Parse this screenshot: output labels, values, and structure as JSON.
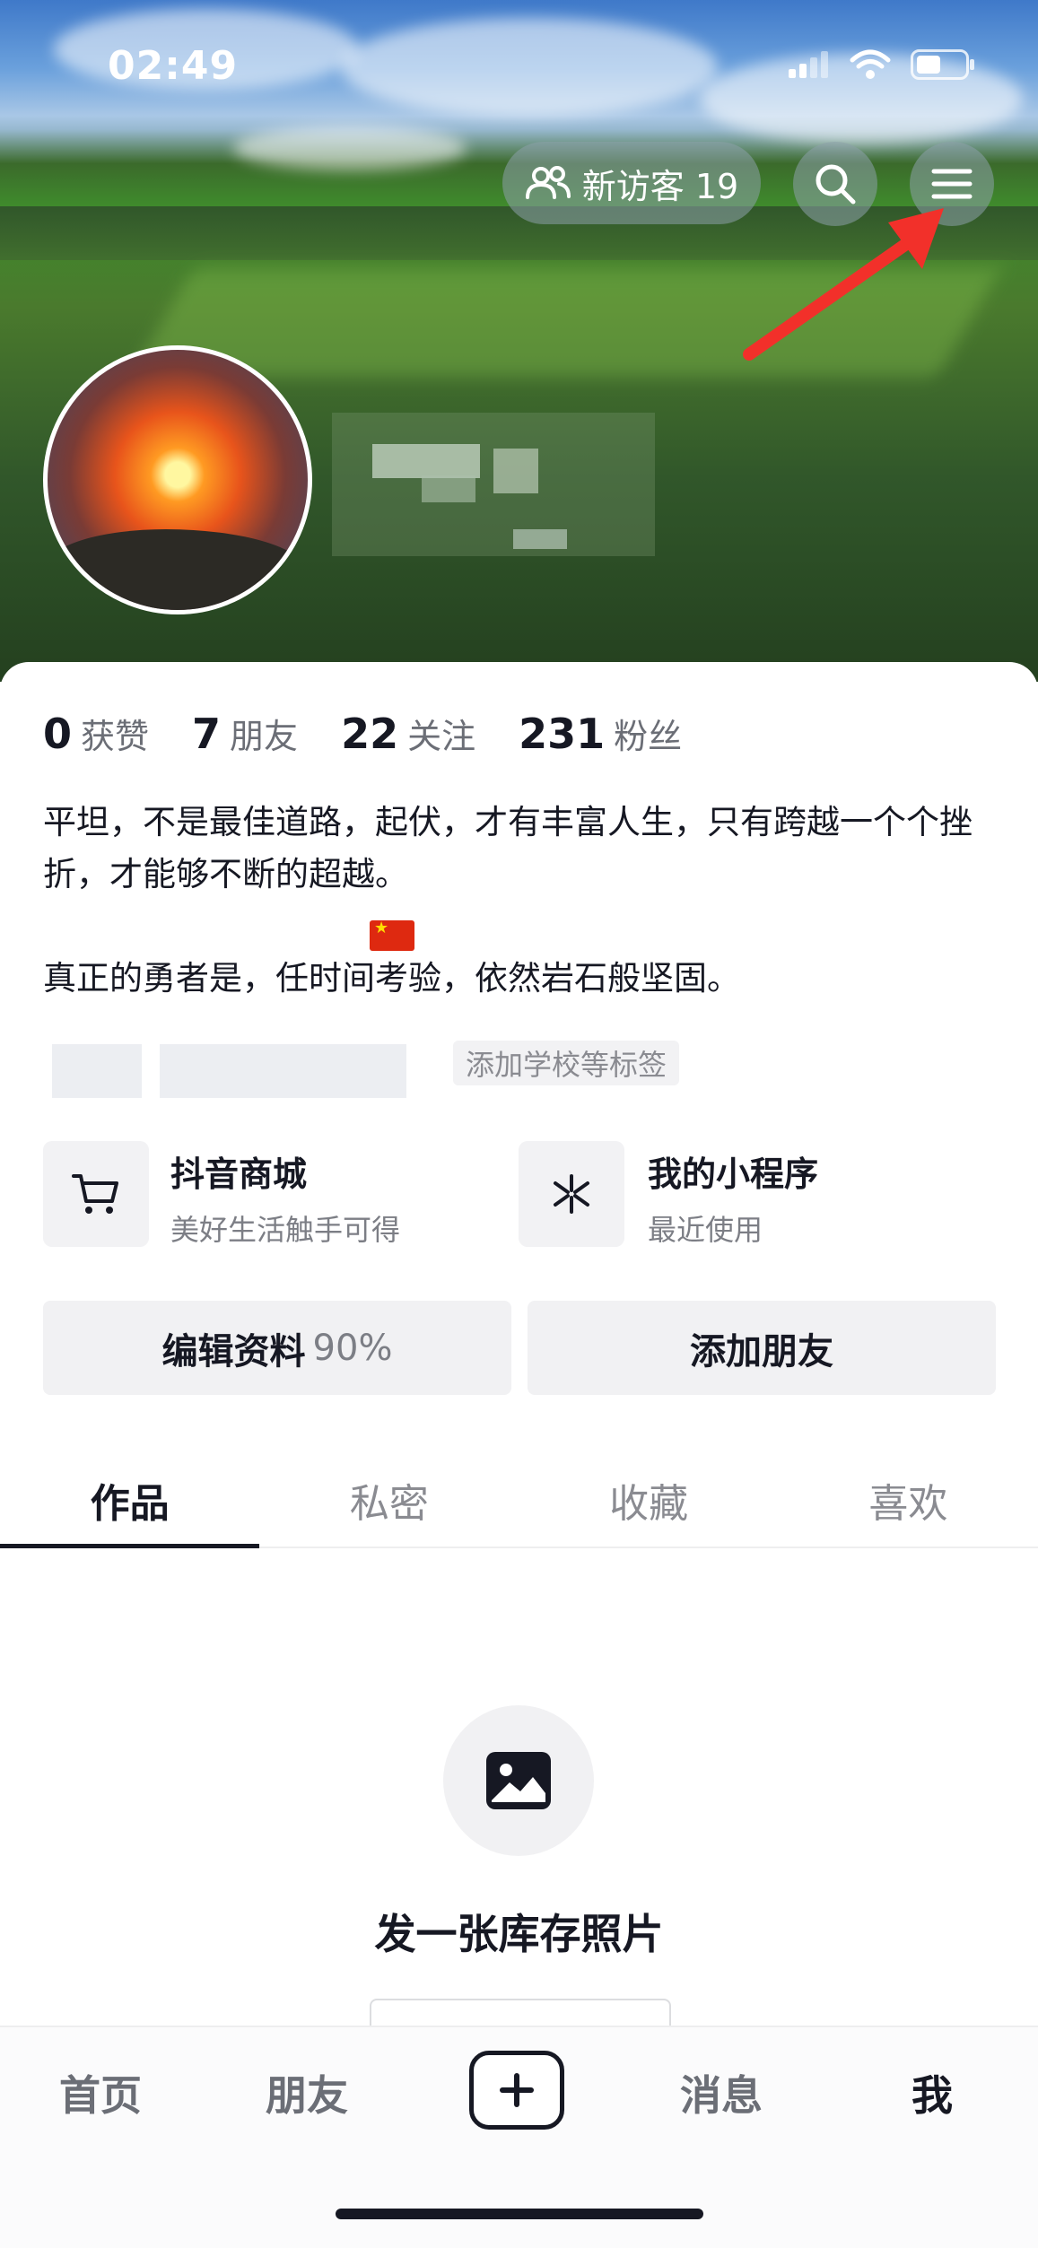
{
  "status_bar": {
    "time": "02:49"
  },
  "header": {
    "visitors_label": "新访客 19"
  },
  "stats": [
    {
      "value": "0",
      "label": "获赞"
    },
    {
      "value": "7",
      "label": "朋友"
    },
    {
      "value": "22",
      "label": "关注"
    },
    {
      "value": "231",
      "label": "粉丝"
    }
  ],
  "bio": {
    "line1": "平坦，不是最佳道路，起伏，才有丰富人生，只有跨越一个个挫折，才能够不断的超越。",
    "line3": "真正的勇者是，任时间考验，依然岩石般坚固。"
  },
  "tags": {
    "add_tag_label": "添加学校等标签"
  },
  "services": [
    {
      "title": "抖音商城",
      "subtitle": "美好生活触手可得",
      "icon": "shopping-cart-icon"
    },
    {
      "title": "我的小程序",
      "subtitle": "最近使用",
      "icon": "mini-program-icon"
    }
  ],
  "actions": {
    "edit_profile": "编辑资料",
    "edit_profile_pct": "90%",
    "add_friend": "添加朋友"
  },
  "tabs": [
    "作品",
    "私密",
    "收藏",
    "喜欢"
  ],
  "empty_state": {
    "text": "发一张库存照片",
    "icon": "image-icon"
  },
  "bottom_nav": [
    "首页",
    "朋友",
    "消息",
    "我"
  ],
  "colors": {
    "annotation_arrow": "#f2302a",
    "text_primary": "#161823"
  }
}
